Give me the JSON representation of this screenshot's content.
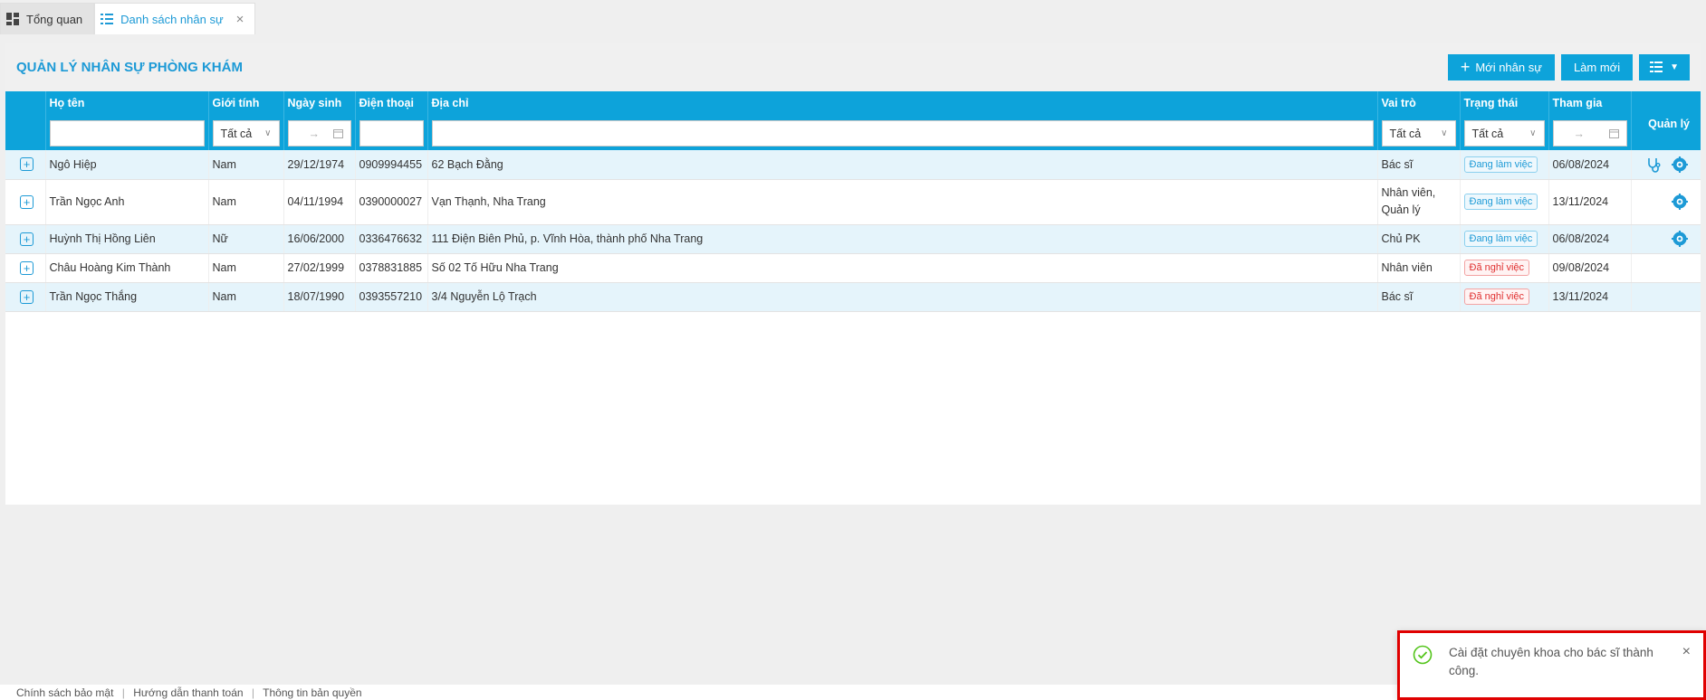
{
  "tabs": [
    {
      "label": "Tổng quan",
      "icon": "dashboard-icon",
      "active": false
    },
    {
      "label": "Danh sách nhân sự",
      "icon": "list-icon",
      "active": true
    }
  ],
  "header": {
    "title": "QUẢN LÝ NHÂN SỰ PHÒNG KHÁM",
    "new_staff_label": "Mới nhân sự",
    "refresh_label": "Làm mới"
  },
  "columns": {
    "name": "Họ tên",
    "gender": "Giới tính",
    "dob": "Ngày sinh",
    "phone": "Điện thoại",
    "address": "Địa chỉ",
    "role": "Vai trò",
    "status": "Trạng thái",
    "joined": "Tham gia",
    "manage": "Quản lý"
  },
  "filters": {
    "gender": "Tất cả",
    "role": "Tất cả",
    "status": "Tất cả",
    "range_arrow": "→"
  },
  "rows": [
    {
      "name": "Ngô Hiệp",
      "gender": "Nam",
      "dob": "29/12/1974",
      "phone": "0909994455",
      "address": "62 Bạch Đằng",
      "role": "Bác sĩ",
      "role2": "",
      "status": "Đang làm việc",
      "joined": "06/08/2024"
    },
    {
      "name": "Trần Ngọc Anh",
      "gender": "Nam",
      "dob": "04/11/1994",
      "phone": "0390000027",
      "address": "Vạn Thạnh, Nha Trang",
      "role": "Nhân viên,",
      "role2": "Quản lý",
      "status": "Đang làm việc",
      "joined": "13/11/2024"
    },
    {
      "name": "Huỳnh Thị Hồng Liên",
      "gender": "Nữ",
      "dob": "16/06/2000",
      "phone": "0336476632",
      "address": "111 Điện Biên Phủ, p. Vĩnh Hòa, thành phố Nha Trang",
      "role": "Chủ PK",
      "role2": "",
      "status": "Đang làm việc",
      "joined": "06/08/2024"
    },
    {
      "name": "Châu Hoàng Kim Thành",
      "gender": "Nam",
      "dob": "27/02/1999",
      "phone": "0378831885",
      "address": "Số 02 Tố Hữu Nha Trang",
      "role": "Nhân viên",
      "role2": "",
      "status": "Đã nghỉ việc",
      "joined": "09/08/2024"
    },
    {
      "name": "Trần Ngọc Thắng",
      "gender": "Nam",
      "dob": "18/07/1990",
      "phone": "0393557210",
      "address": "3/4 Nguyễn Lộ Trạch",
      "role": "Bác sĩ",
      "role2": "",
      "status": "Đã nghỉ việc",
      "joined": "13/11/2024"
    }
  ],
  "footer": {
    "link1": "Chính sách bảo mật",
    "link2": "Hướng dẫn thanh toán",
    "link3": "Thông tin bản quyền",
    "separator": "|"
  },
  "toast": {
    "message": "Cài đặt chuyên khoa cho bác sĩ thành công."
  },
  "colors": {
    "primary": "#0da3da",
    "alt_row": "#e5f4fb",
    "toast_border": "#e00000"
  }
}
